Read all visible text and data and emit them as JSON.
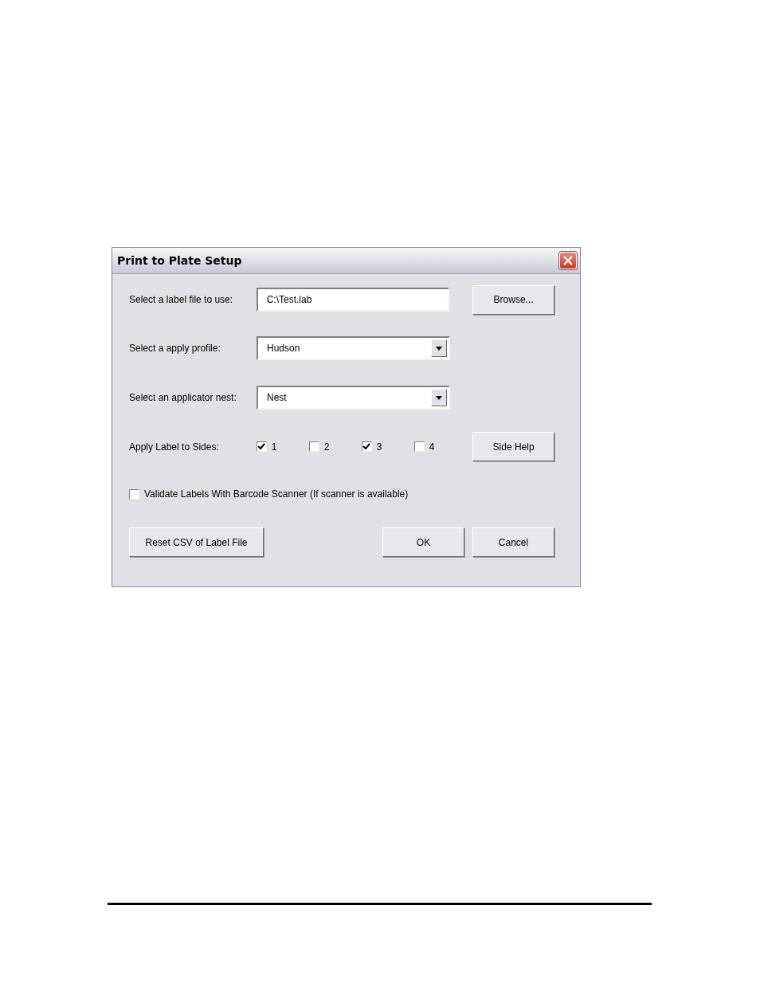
{
  "window": {
    "title": "Print to Plate Setup"
  },
  "fields": [
    {
      "kind": "text",
      "label": "Select a label file to use:",
      "value": "C:\\Test.lab"
    },
    {
      "kind": "dropdown",
      "label": "Select a apply profile:",
      "value": "Hudson"
    },
    {
      "kind": "dropdown",
      "label": "Select an applicator nest:",
      "value": "Nest"
    }
  ],
  "browse_button": "Browse...",
  "sides": {
    "label": "Apply Label to Sides:",
    "options": [
      {
        "label": "1",
        "checked": true
      },
      {
        "label": "2",
        "checked": false
      },
      {
        "label": "3",
        "checked": true
      },
      {
        "label": "4",
        "checked": false
      }
    ]
  },
  "side_help_button": "Side Help",
  "validate": {
    "label": "Validate Labels With Barcode Scanner (If scanner is available)",
    "checked": false
  },
  "buttons": [
    "Reset CSV of Label File",
    "OK",
    "Cancel"
  ]
}
